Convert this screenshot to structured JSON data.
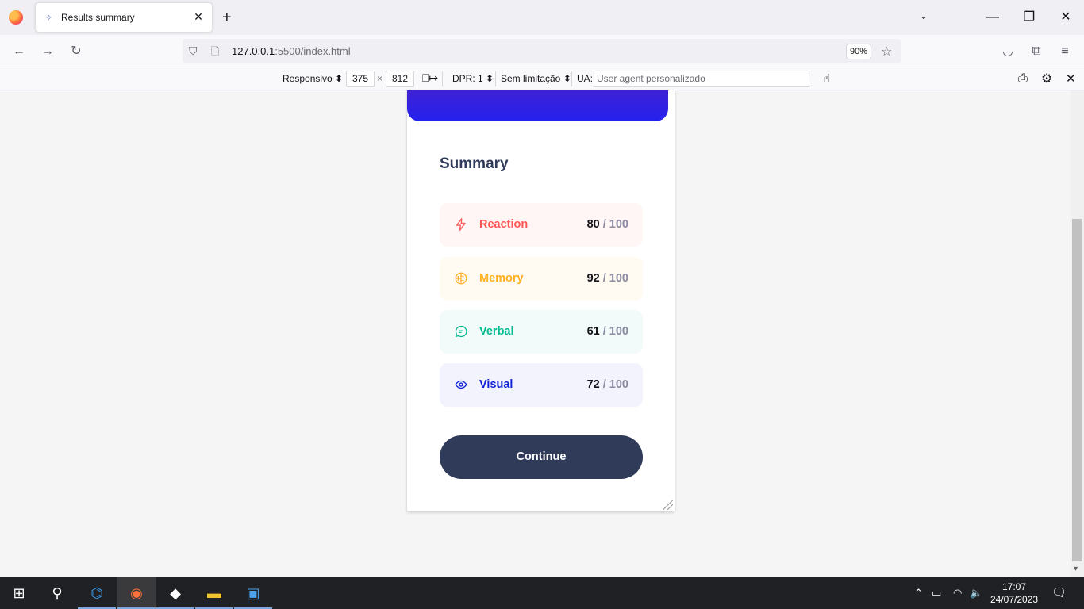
{
  "browser": {
    "tab_title": "Results summary",
    "tab_close_glyph": "✕",
    "new_tab_glyph": "+",
    "list_tabs_glyph": "⌄",
    "window_buttons": [
      "—",
      "❐",
      "✕"
    ],
    "url_host": "127.0.0.1",
    "url_rest": ":5500/index.html",
    "zoom": "90%",
    "icons": [
      "firefox-logo",
      "shield-icon",
      "page-icon",
      "star-icon",
      "pocket-icon",
      "extensions-icon",
      "menu-icon"
    ]
  },
  "rdm": {
    "device_select": "Responsivo",
    "width": "375",
    "times": "×",
    "height": "812",
    "dpr": "DPR: 1",
    "throttling": "Sem limitação",
    "ua_label": "UA:",
    "ua_placeholder": "User agent personalizado"
  },
  "page": {
    "summary_title": "Summary",
    "categories": [
      {
        "label": "Reaction",
        "score": "80",
        "max": "/ 100",
        "color": "#ff5757",
        "bg": "#fff6f5",
        "icon": "lightning-icon"
      },
      {
        "label": "Memory",
        "score": "92",
        "max": "/ 100",
        "color": "#ffb01f",
        "bg": "#fffbf2",
        "icon": "brain-icon"
      },
      {
        "label": "Verbal",
        "score": "61",
        "max": "/ 100",
        "color": "#00bb8f",
        "bg": "#f2fbfa",
        "icon": "chat-icon"
      },
      {
        "label": "Visual",
        "score": "72",
        "max": "/ 100",
        "color": "#1125d6",
        "bg": "#f3f3fd",
        "icon": "eye-icon"
      }
    ],
    "continue_label": "Continue"
  },
  "taskbar": {
    "time": "17:07",
    "date": "24/07/2023"
  }
}
